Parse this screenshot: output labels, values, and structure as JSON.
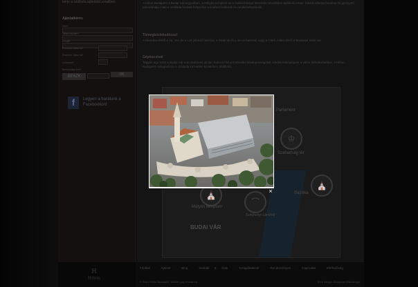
{
  "sidebar": {
    "intro": "kérje a szálloda ajánlatát emailben",
    "section_title": "Ajánlatkérés",
    "form": {
      "labels": [
        "Név*",
        "Telefonszám*",
        "Email*",
        "Érkezés dátuma*",
        "Érkezés dátuma*",
        "Létszám*",
        "Biztonsági kód*"
      ],
      "captcha": "BE6ZK",
      "ok_label": "OK"
    },
    "facebook": {
      "icon": "f",
      "text": "Legyen a barátunk a Facebookon!"
    }
  },
  "main": {
    "intro_text": "A Hilton Budapest a Budai Várnegyedben, a Mátyás-templom és a Halászbástya közvetlen közelében található Hotel. Ideális elhelyezkedése és gyönyörű panorámája miatt a szálloda kedvelt helyszíne a konferenciáknak és rendezvényeknek.",
    "transport_title": "Tömegközlekedéssel",
    "transport_text": "A Moszkva térről a 16, 16A és a 116 jelzésű busszal, a Deák térről a 16-os busszal, vagy a Clark Ádám térről a Budavári Sikló-val.",
    "car_title": "Gépkocsival",
    "car_text": "Tegyen egy sétát a Budai Vár macskaköves utcáin, fedezze fel a történelmi látványosságokat. Ideális kiindulópont a város felfedezéséhez. A Hilton Budapest mélygarázsa a szálloda közvetlen közelében található.",
    "map_labels": {
      "parliament": "Parlament",
      "square": "Szabadság tér",
      "basilica": "Bazilika",
      "church": "Mátyás templom",
      "castle": "BUDAI VÁR",
      "bridge": "Széchenyi Lánchíd"
    },
    "map_icons": [
      "crown-icon",
      "church-icon",
      "bridge-icon"
    ]
  },
  "lightbox": {
    "close_label": "×"
  },
  "footer": {
    "nav": [
      "Főoldal",
      "Ajánlat",
      "Blog",
      "Szobák & Árak",
      "Szolgáltatások",
      "Rendezvények",
      "Kapcsolat",
      "Elérhetőség"
    ],
    "copyright": "© 2012 Hilton Budapest. Minden jog fenntartva.",
    "right_text": "Web design: Budapest Webdesign"
  },
  "brand": {
    "logo_mark": "H",
    "logo_word": "Hilton"
  }
}
